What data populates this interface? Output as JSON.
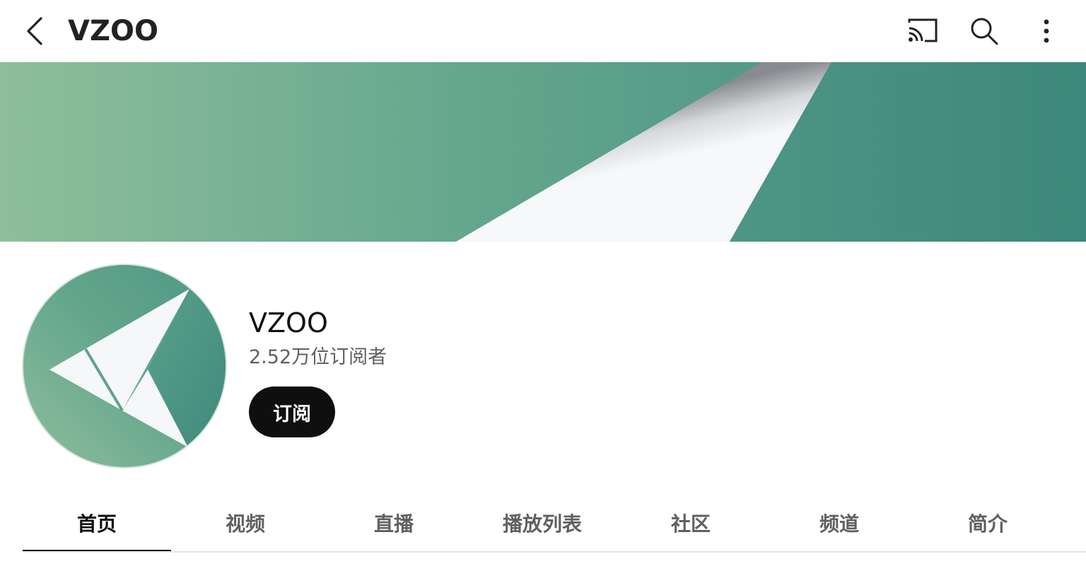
{
  "header": {
    "title": "VZOO",
    "back_icon": "chevron-left-icon",
    "actions": [
      "cast-icon",
      "search-icon",
      "more-vert-icon"
    ]
  },
  "theme": {
    "brand_green": "#5a9e87",
    "banner_light": "#8ebe9b",
    "banner_dark": "#3f8a7e",
    "paper": "#f7f8fa",
    "button_bg": "#0f0f0f"
  },
  "channel": {
    "name": "VZOO",
    "subscribers": "2.52万位订阅者",
    "subscribe_label": "订阅"
  },
  "tabs": [
    {
      "label": "首页",
      "active": true
    },
    {
      "label": "视频",
      "active": false
    },
    {
      "label": "直播",
      "active": false
    },
    {
      "label": "播放列表",
      "active": false
    },
    {
      "label": "社区",
      "active": false
    },
    {
      "label": "频道",
      "active": false
    },
    {
      "label": "简介",
      "active": false
    }
  ]
}
